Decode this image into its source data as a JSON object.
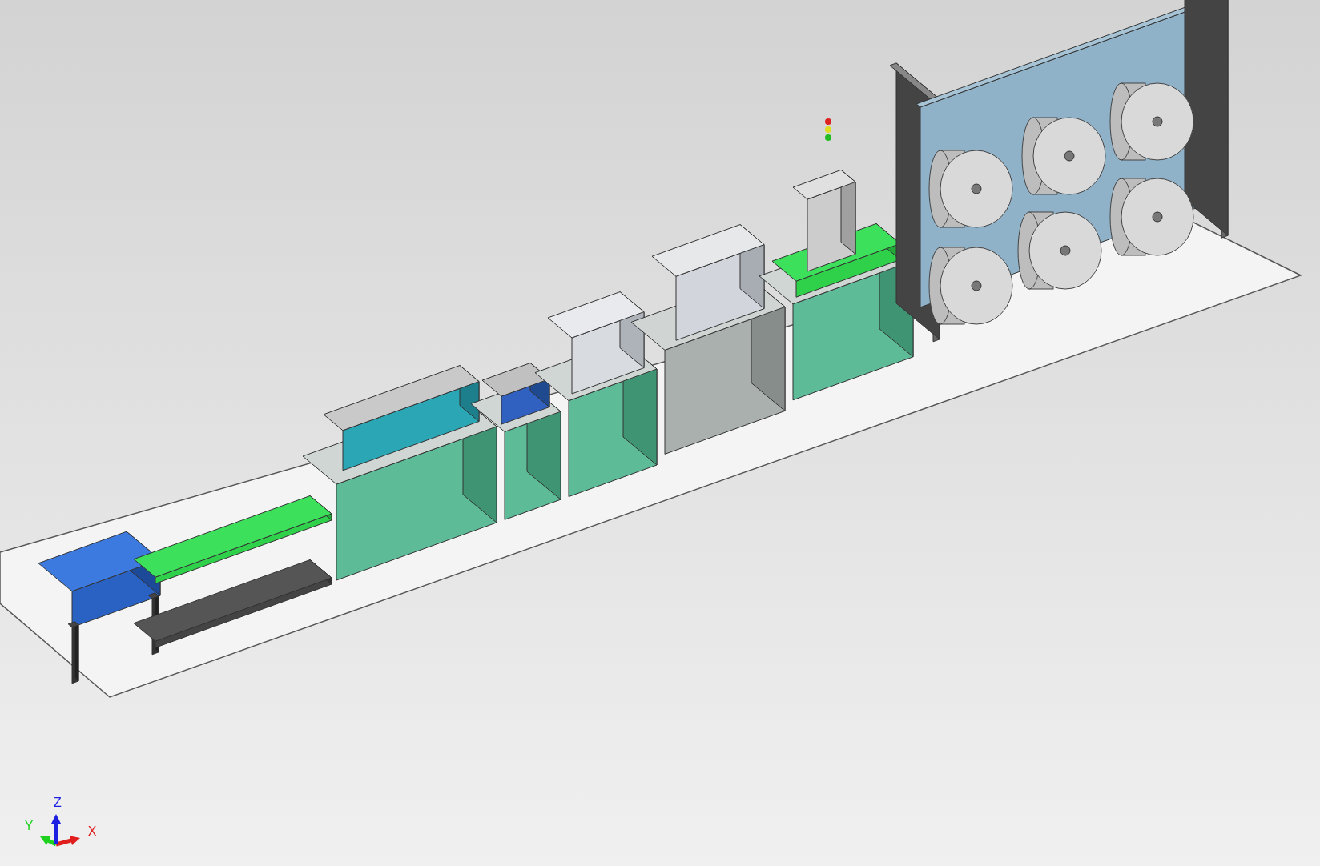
{
  "triad": [
    {
      "label": "X",
      "color": "#e01e1e"
    },
    {
      "label": "Y",
      "color": "#1fd11f"
    },
    {
      "label": "Z",
      "color": "#1c1fe0"
    }
  ]
}
